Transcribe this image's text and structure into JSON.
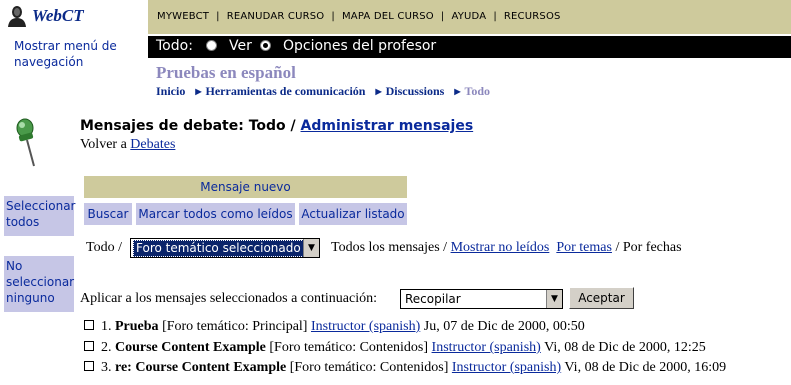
{
  "brand": "WebCT",
  "topnav": [
    "MYWEBCT",
    "REANUDAR CURSO",
    "MAPA DEL CURSO",
    "AYUDA",
    "RECURSOS"
  ],
  "show_nav_menu": "Mostrar menú de navegación",
  "view_bar": {
    "all_label": "Todo:",
    "option_view": "Ver",
    "option_professor": "Opciones del profesor",
    "selected": "Opciones del profesor"
  },
  "course_title": "Pruebas en español",
  "breadcrumb": [
    "Inicio",
    "Herramientas de comunicación",
    "Discussions",
    "Todo"
  ],
  "page": {
    "heading_prefix": "Mensajes de debate: Todo /",
    "heading_link": "Administrar mensajes",
    "back_prefix": "Volver a",
    "back_link": "Debates"
  },
  "side_buttons": {
    "select_all": "Seleccionar todos",
    "select_none": "No seleccionar ninguno"
  },
  "actions": {
    "new_message": "Mensaje nuevo",
    "search": "Buscar",
    "mark_read": "Marcar todos como leídos",
    "refresh": "Actualizar listado"
  },
  "filter": {
    "prefix": "Todo /",
    "forum_select": "Foro temático seleccionado",
    "all_messages": "Todos los mensajes /",
    "show_unread": "Mostrar no leídos",
    "by_topic": "Por temas",
    "by_date": "/ Por fechas"
  },
  "apply": {
    "label": "Aplicar a los mensajes seleccionados a continuación:",
    "select_value": "Recopilar",
    "accept": "Aceptar"
  },
  "messages": [
    {
      "num": "1.",
      "title": "Prueba",
      "forum": "[Foro temático: Principal]",
      "author": "Instructor (spanish)",
      "date": "Ju, 07 de Dic de 2000, 00:50"
    },
    {
      "num": "2.",
      "title": "Course Content Example",
      "forum": "[Foro temático: Contenidos]",
      "author": "Instructor (spanish)",
      "date": "Vi, 08 de Dic de 2000, 12:25"
    },
    {
      "num": "3.",
      "title": "re: Course Content Example",
      "forum": "[Foro temático: Contenidos]",
      "author": "Instructor (spanish)",
      "date": "Vi, 08 de Dic de 2000, 16:09"
    }
  ]
}
